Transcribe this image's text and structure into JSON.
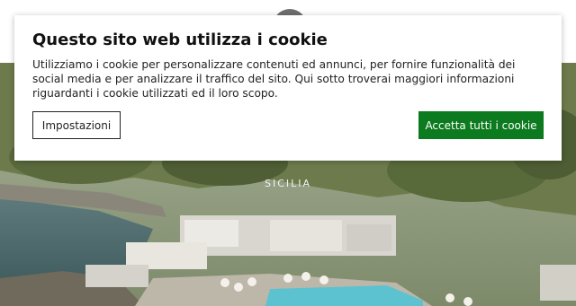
{
  "site": {
    "logo_icon": "logo-emblem",
    "hero_caption": "SICILIA"
  },
  "cookie_banner": {
    "title": "Questo sito web utilizza i cookie",
    "description": "Utilizziamo i cookie per personalizzare contenuti ed annunci, per fornire funzionalità dei social media e per analizzare il traffico del sito. Qui sotto troverai maggiori informazioni riguardanti i cookie utilizzati ed il loro scopo.",
    "settings_label": "Impostazioni",
    "accept_label": "Accetta tutti i cookie"
  },
  "colors": {
    "accept_button": "#0c7a1e",
    "banner_background": "#ffffff"
  }
}
